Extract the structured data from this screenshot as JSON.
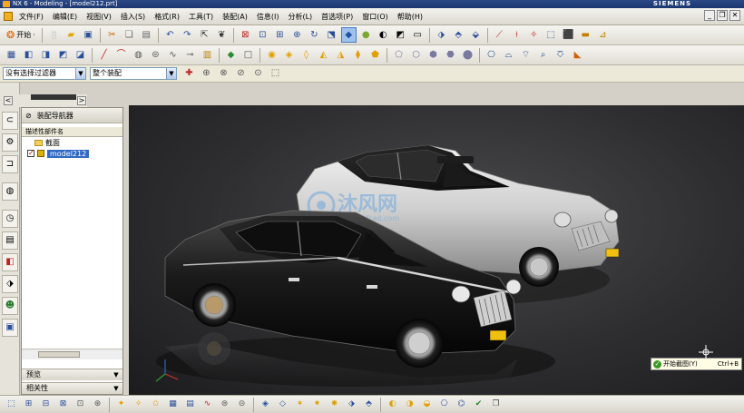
{
  "window": {
    "title": "NX 6 - Modeling - [model212.prt]",
    "brand": "SIEMENS"
  },
  "menu": [
    "文件(F)",
    "编辑(E)",
    "视图(V)",
    "插入(S)",
    "格式(R)",
    "工具(T)",
    "装配(A)",
    "信息(I)",
    "分析(L)",
    "首选项(P)",
    "窗口(O)",
    "帮助(H)"
  ],
  "toolbar": {
    "start_label": "开始",
    "start_suffix": "·",
    "row1_icons": [
      "new-icon",
      "open-icon",
      "save-icon",
      "cut-icon",
      "copy-icon",
      "paste-icon",
      "undo-icon",
      "redo-icon",
      "select-icon",
      "command-finder-icon",
      "fit-icon",
      "zoom-icon",
      "zoom-window-icon",
      "pan-icon",
      "rotate-icon",
      "perspective-icon",
      "shaded-icon",
      "render-style-icon",
      "half-shade-icon",
      "background-icon",
      "section-icon",
      "snap-icon",
      "wcs-icon",
      "orient-icon",
      "dimension-icon",
      "measure-icon",
      "analysis-icon",
      "grid-icon",
      "shading-icon"
    ],
    "row2_icons": [
      "sketch-icon",
      "extrude-icon",
      "revolve-icon",
      "sweep-icon",
      "trim-icon",
      "line-icon",
      "arc-icon",
      "point-icon",
      "plane-icon",
      "hole-icon",
      "boss-icon",
      "pocket-icon",
      "datum-icon",
      "block-icon",
      "blend-icon",
      "chamfer-icon",
      "shell-icon",
      "draft-icon",
      "pattern-icon",
      "mirror-icon",
      "surface-icon",
      "mesh-icon",
      "thicken-icon",
      "offset-icon",
      "sew-icon",
      "extract-icon",
      "bridge-icon",
      "curve-icon",
      "face-icon",
      "edge-icon"
    ],
    "row3_icons": [
      "snap-point-icon",
      "snap-end-icon",
      "snap-mid-icon",
      "snap-center-icon",
      "snap-quadrant-icon"
    ]
  },
  "filters": {
    "type_filter": "没有选择过滤器",
    "assembly_filter": "整个装配"
  },
  "navigator": {
    "title": "装配导航器",
    "column_header": "描述性部件名",
    "tree": [
      {
        "label": "截面",
        "type": "folder",
        "selected": false
      },
      {
        "label": "model212",
        "type": "part",
        "checked": true,
        "selected": true
      }
    ],
    "sections": [
      "预览",
      "相关性"
    ]
  },
  "viewport": {
    "watermark_cn": "沐风网",
    "watermark_en": "www.mfcad.com",
    "front_car_plate": "",
    "rear_car_plate": ""
  },
  "toast": {
    "text": "开始截图(Y)",
    "shortcut": "Ctrl+B"
  },
  "statusbar": {
    "icons": [
      "select-all-icon",
      "add-component-icon",
      "move-component-icon",
      "constraint-icon",
      "explode-icon",
      "mate-icon",
      "array-icon",
      "replace-icon",
      "clearance-icon",
      "sequence-icon",
      "bom-icon",
      "wave-icon",
      "reference-set-icon",
      "link-icon",
      "suppress-icon",
      "deform-icon",
      "pattern-component-icon",
      "mirror-assembly-icon",
      "edit-arrangement-icon",
      "show-only-icon",
      "hide-icon",
      "display-icon",
      "envelope-icon",
      "weight-icon",
      "route-icon",
      "product-interface-icon",
      "check-icon",
      "cloning-icon"
    ]
  },
  "colors": {
    "titlebar": "#1f3d7a",
    "selection": "#316ac5",
    "viewport_bg": "#2e2e30",
    "front_car": "#151515",
    "rear_car": "#d6d6d6"
  }
}
